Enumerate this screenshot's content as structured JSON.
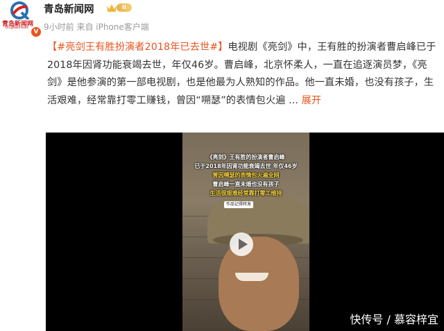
{
  "account": {
    "name": "青岛新闻网",
    "avatar_text": "青岛新闻网",
    "avatar_sub": "Qingdaonews",
    "verified_mark": "V",
    "vip_label": "II",
    "time": "9小时前",
    "source": "来自 iPhone客户端"
  },
  "post": {
    "hashtag": "【#亮剑王有胜扮演者2018年已去世#】",
    "body": "电视剧《亮剑》中，王有胜的扮演者曹启峰已于2018年因肾功能衰竭去世，年仅46岁。曹启峰，北京怀柔人，一直在追逐演员梦，《亮剑》是他参演的第一部电视剧，也是他最为人熟知的作品。他一直未婚，也没有孩子，生活艰难，经常靠打零工赚钱，曾因“嗍瑟”的表情包火遍 ...",
    "expand_label": "展开"
  },
  "video": {
    "overlay_lines": [
      "《亮剑》王有胜的扮演者曹启峰",
      "已于2018年因肾功能衰竭去世 年仅46岁",
      "曾因嗍瑟的表情包火遍全网",
      "曹启峰一直未婚也没有孩子",
      "生活很艰难经常靠打零工维持"
    ],
    "small_button": "作品记得转发",
    "watermark": "快传号 / 慕容梓宜"
  },
  "colors": {
    "accent": "#e8541e",
    "overlay_yellow": "#f5d23a"
  }
}
